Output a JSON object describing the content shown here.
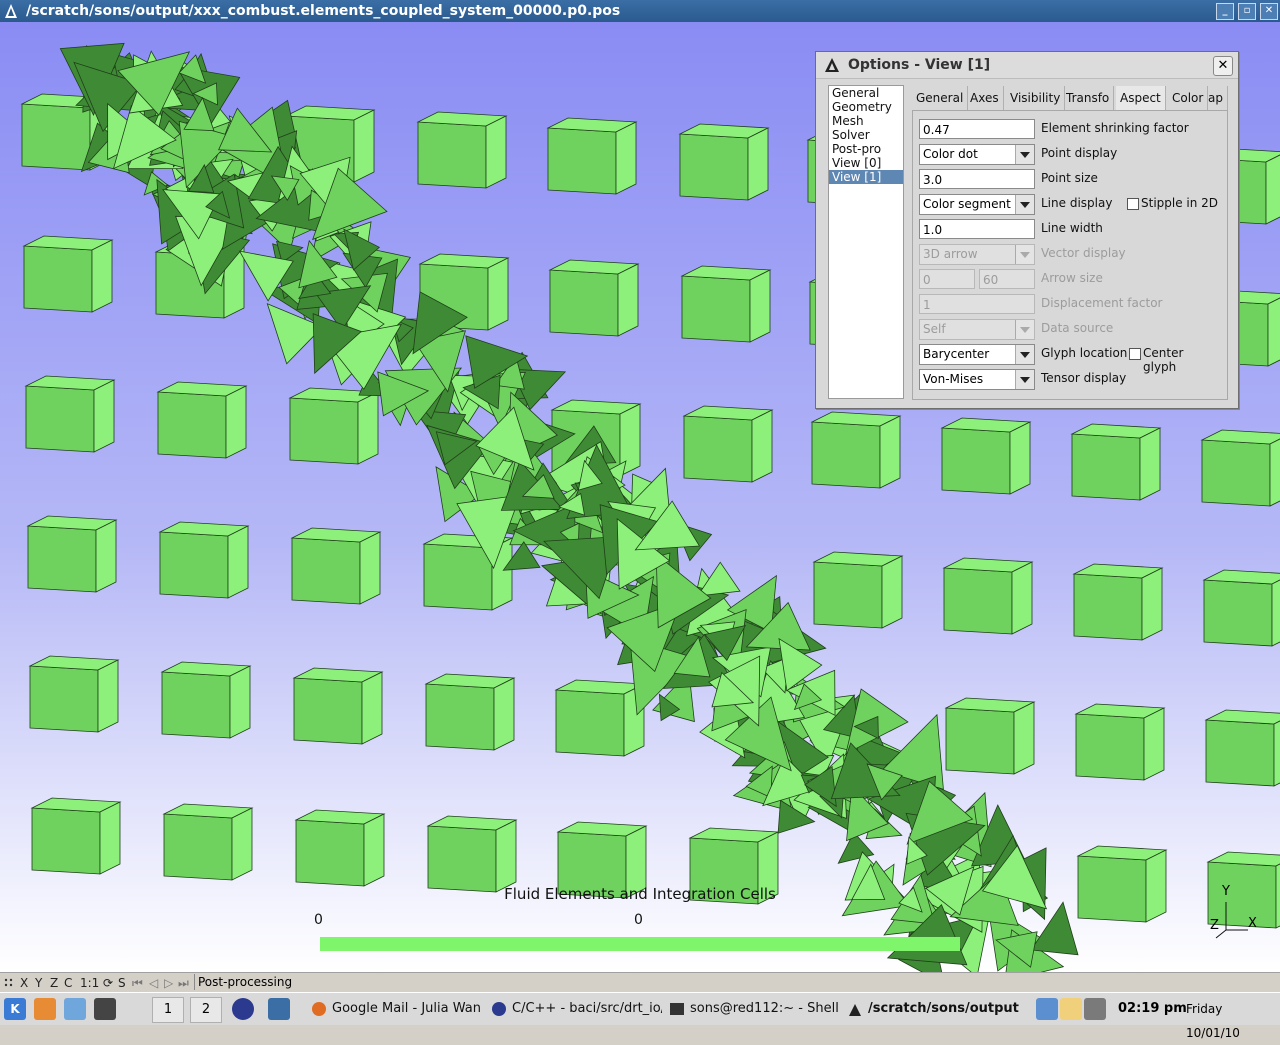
{
  "window": {
    "title": "/scratch/sons/output/xxx_combust.elements_coupled_system_00000.p0.pos",
    "minimize": "_",
    "maximize": "▫",
    "close": "✕"
  },
  "colors": {
    "cube_light": "#8cf07a",
    "cube_mid": "#6fd25e",
    "cube_dark": "#3f8a34",
    "edge": "#1f3f1a",
    "scale_bar": "#7ef56b"
  },
  "scene": {
    "title": "Fluid Elements and Integration Cells",
    "scale_min": "0",
    "scale_max": "0",
    "axes": {
      "y": "Y",
      "z": "Z",
      "x": "X"
    }
  },
  "dialog": {
    "title": "Options - View [1]",
    "close": "✕",
    "tree": [
      "General",
      "Geometry",
      "Mesh",
      "Solver",
      "Post-pro",
      "View [0]",
      "View [1]"
    ],
    "tree_selected": 6,
    "tabs": [
      "General",
      "Axes",
      "Visibility",
      "Transfo",
      "Aspect",
      "Color",
      "ap"
    ],
    "active_tab": 4,
    "rows": [
      {
        "kind": "input",
        "value": "0.47",
        "label": "Element shrinking factor",
        "disabled": false
      },
      {
        "kind": "select",
        "value": "Color dot",
        "label": "Point display",
        "disabled": false
      },
      {
        "kind": "input",
        "value": "3.0",
        "label": "Point size",
        "disabled": false
      },
      {
        "kind": "select",
        "value": "Color segment",
        "label": "Line display",
        "disabled": false,
        "check": "Stipple in 2D"
      },
      {
        "kind": "input",
        "value": "1.0",
        "label": "Line width",
        "disabled": false
      },
      {
        "kind": "select",
        "value": "3D arrow",
        "label": "Vector display",
        "disabled": true
      },
      {
        "kind": "pair",
        "value": "0",
        "value2": "60",
        "label": "Arrow size",
        "disabled": true
      },
      {
        "kind": "input",
        "value": "1",
        "label": "Displacement factor",
        "disabled": true
      },
      {
        "kind": "select",
        "value": "Self",
        "label": "Data source",
        "disabled": true
      },
      {
        "kind": "select",
        "value": "Barycenter",
        "label": "Glyph location",
        "disabled": false,
        "check": "Center glyph"
      },
      {
        "kind": "select",
        "value": "Von-Mises",
        "label": "Tensor display",
        "disabled": false
      }
    ]
  },
  "statusbar": {
    "buttons": [
      "X",
      "Y",
      "Z",
      "C",
      "1:1",
      "S"
    ],
    "message": "Post-processing"
  },
  "taskbar": {
    "desktops": [
      "1",
      "2"
    ],
    "items": [
      "Google Mail - Julia Wan",
      "C/C++ - baci/src/drt_io/",
      "sons@red112:~ - Shell",
      "/scratch/sons/output"
    ],
    "time": "02:19 pm",
    "day": "Friday",
    "date": "10/01/10"
  }
}
